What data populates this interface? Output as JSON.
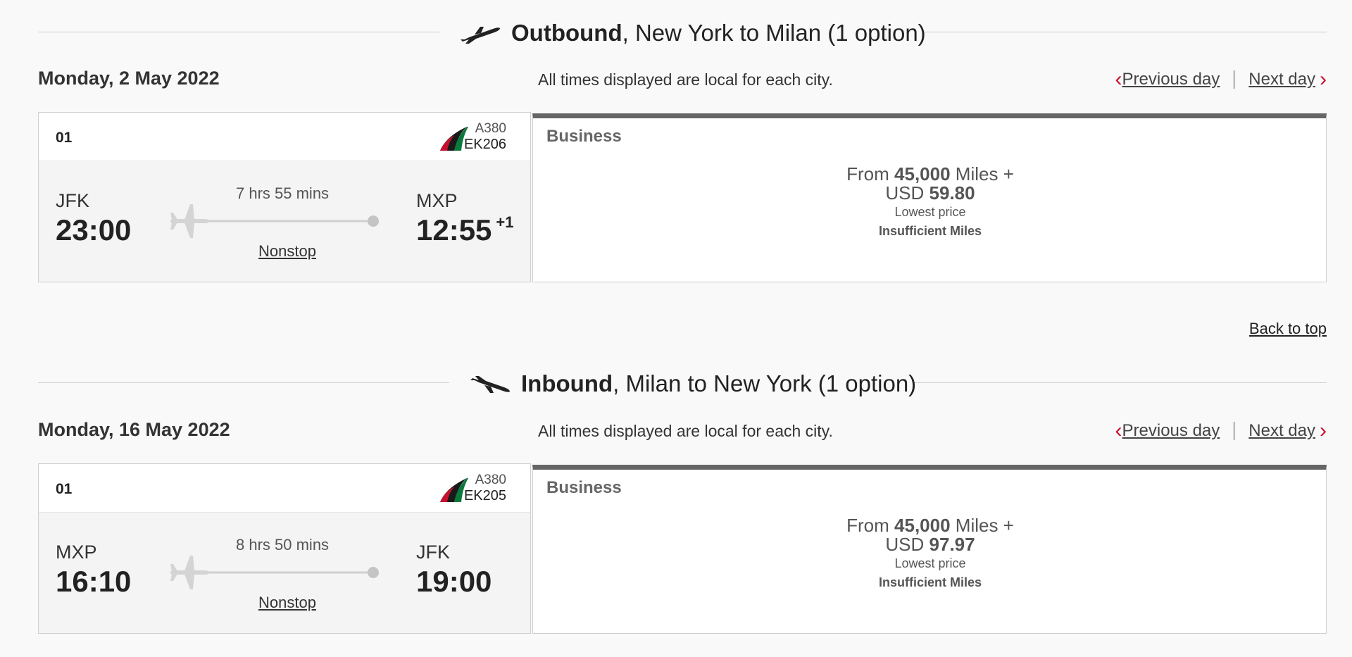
{
  "outbound": {
    "title_bold": "Outbound",
    "title_rest": ", New York to Milan (1 option)",
    "date": "Monday, 2 May 2022",
    "times_note": "All times displayed are local for each city.",
    "prev_day": "Previous day",
    "next_day": "Next day",
    "flight": {
      "number": "01",
      "aircraft": "A380",
      "flight_no": "EK206",
      "origin_code": "JFK",
      "origin_time": "23:00",
      "duration": "7 hrs 55 mins",
      "stops": "Nonstop",
      "dest_code": "MXP",
      "dest_time": "12:55",
      "day_offset": "+1"
    },
    "fare": {
      "cabin": "Business",
      "from_prefix": "From",
      "miles": "45,000",
      "miles_suffix": "Miles +",
      "currency": "USD",
      "amount": "59.80",
      "lowest": "Lowest price",
      "status": "Insufficient Miles"
    }
  },
  "back_to_top": "Back to top",
  "inbound": {
    "title_bold": "Inbound",
    "title_rest": ", Milan to New York (1 option)",
    "date": "Monday, 16 May 2022",
    "times_note": "All times displayed are local for each city.",
    "prev_day": "Previous day",
    "next_day": "Next day",
    "flight": {
      "number": "01",
      "aircraft": "A380",
      "flight_no": "EK205",
      "origin_code": "MXP",
      "origin_time": "16:10",
      "duration": "8 hrs 50 mins",
      "stops": "Nonstop",
      "dest_code": "JFK",
      "dest_time": "19:00"
    },
    "fare": {
      "cabin": "Business",
      "from_prefix": "From",
      "miles": "45,000",
      "miles_suffix": "Miles +",
      "currency": "USD",
      "amount": "97.97",
      "lowest": "Lowest price",
      "status": "Insufficient Miles"
    }
  },
  "colors": {
    "accent": "#c8102e",
    "fare_top_bar": "#666666",
    "line": "#cfcfcf"
  },
  "icons": {
    "takeoff": "takeoff-plane-icon",
    "landing": "landing-plane-icon",
    "route": "plane-icon",
    "prev": "chevron-left-icon",
    "next": "chevron-right-icon",
    "airline": "emirates-logo"
  }
}
